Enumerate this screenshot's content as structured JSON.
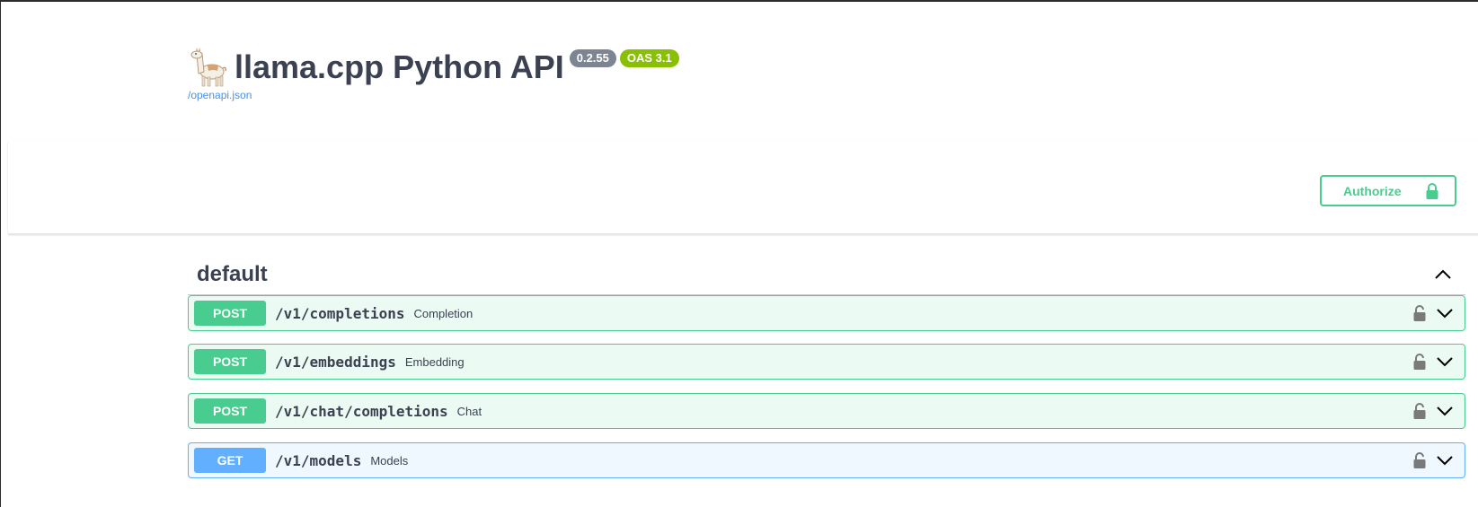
{
  "info": {
    "title": "llama.cpp Python API",
    "version": "0.2.55",
    "oas_version": "OAS 3.1",
    "spec_link": "/openapi.json"
  },
  "auth": {
    "authorize_label": "Authorize"
  },
  "tag": {
    "name": "default"
  },
  "operations": [
    {
      "method": "POST",
      "path": "/v1/completions",
      "summary": "Completion"
    },
    {
      "method": "POST",
      "path": "/v1/embeddings",
      "summary": "Embedding"
    },
    {
      "method": "POST",
      "path": "/v1/chat/completions",
      "summary": "Chat"
    },
    {
      "method": "GET",
      "path": "/v1/models",
      "summary": "Models"
    }
  ],
  "colors": {
    "post": "#49cc90",
    "get": "#61affe",
    "version_badge": "#7d8492",
    "oas_badge": "#89bf04",
    "link": "#4990e2",
    "text": "#3b4151"
  },
  "icons": {
    "logo": "llama-icon",
    "lock": "lock-icon",
    "expand": "chevron-down-icon",
    "collapse": "chevron-up-icon"
  }
}
